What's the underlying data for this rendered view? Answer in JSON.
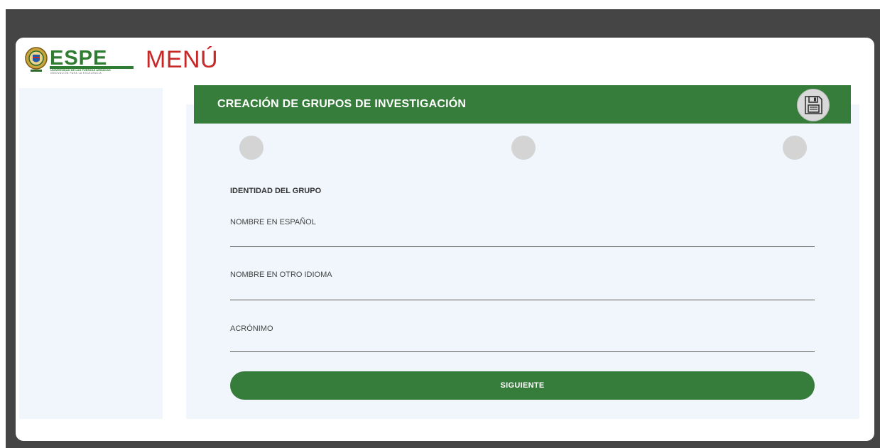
{
  "brand": {
    "logo_text": "ESPE",
    "logo_subtitle": "UNIVERSIDAD DE LAS FUERZAS ARMADAS",
    "logo_tagline": "INNOVACIÓN PARA LA EXCELENCIA",
    "menu_label": "MENÚ"
  },
  "header": {
    "title": "CREACIÓN DE GRUPOS DE INVESTIGACIÓN",
    "save_icon": "floppy-disk-icon"
  },
  "steps": {
    "count": 3,
    "color": "#d4d4d4"
  },
  "form": {
    "section_title": "IDENTIDAD DEL GRUPO",
    "fields": [
      {
        "label": "NOMBRE EN ESPAÑOL",
        "value": ""
      },
      {
        "label": "NOMBRE EN OTRO IDIOMA",
        "value": ""
      },
      {
        "label": "ACRÓNIMO",
        "value": ""
      }
    ],
    "submit_label": "SIGUIENTE"
  },
  "colors": {
    "primary_green": "#367c3a",
    "menu_red": "#c62828",
    "panel_bg": "#f0f6fc",
    "frame_bg": "#454545"
  }
}
